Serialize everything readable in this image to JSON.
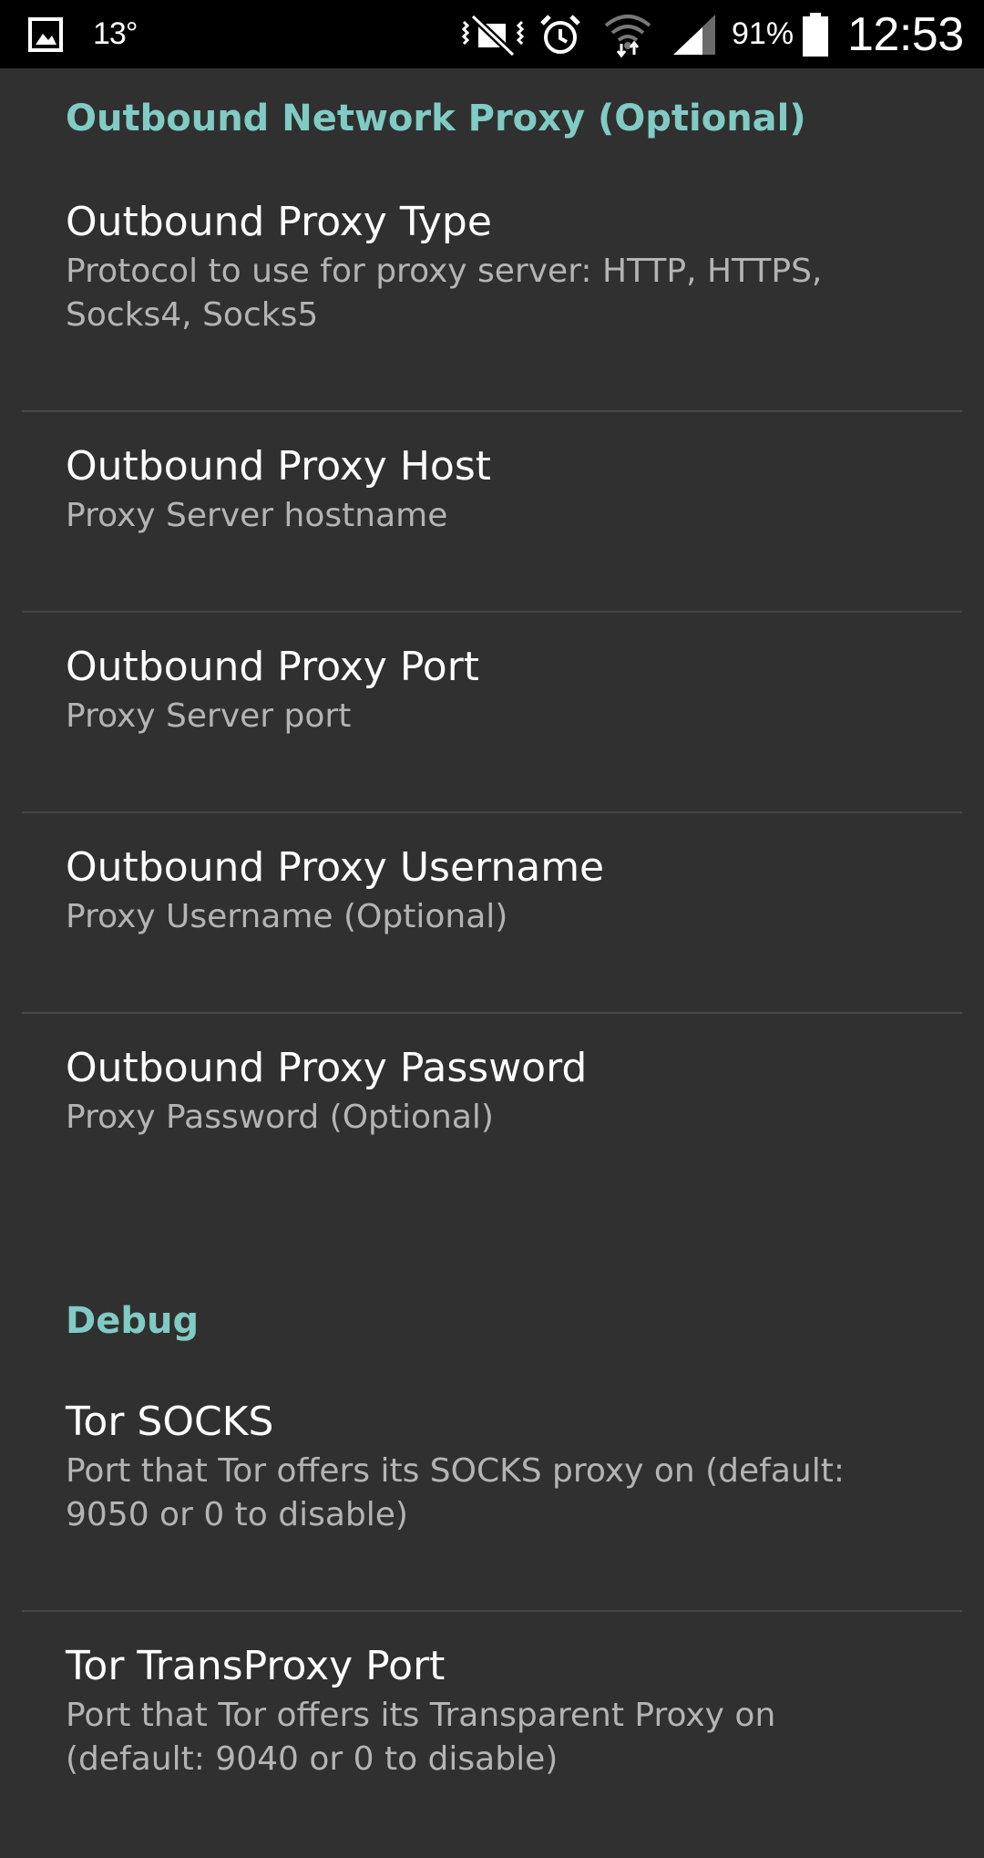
{
  "status_bar": {
    "temperature": "13°",
    "battery_percent": "91%",
    "time": "12:53",
    "icons": [
      "gallery-icon",
      "vibrate-mute-icon",
      "alarm-icon",
      "wifi-icon",
      "cell-signal-icon",
      "battery-icon"
    ]
  },
  "categories": {
    "proxy": "Outbound Network Proxy (Optional)",
    "debug": "Debug"
  },
  "preferences": [
    {
      "title": "Outbound Proxy Type",
      "summary": "Protocol to use for proxy server: HTTP, HTTPS, Socks4, Socks5"
    },
    {
      "title": "Outbound Proxy Host",
      "summary": "Proxy Server hostname"
    },
    {
      "title": "Outbound Proxy Port",
      "summary": "Proxy Server port"
    },
    {
      "title": "Outbound Proxy Username",
      "summary": "Proxy Username (Optional)"
    },
    {
      "title": "Outbound Proxy Password",
      "summary": "Proxy Password (Optional)"
    },
    {
      "title": "Tor SOCKS",
      "summary": "Port that Tor offers its SOCKS proxy on (default: 9050 or 0 to disable)"
    },
    {
      "title": "Tor TransProxy Port",
      "summary": "Port that Tor offers its Transparent Proxy on (default: 9040 or 0 to disable)"
    }
  ],
  "colors": {
    "background": "#303030",
    "accent": "#80cbc4",
    "summary_text": "#b4b4b4",
    "divider": "#474747"
  }
}
